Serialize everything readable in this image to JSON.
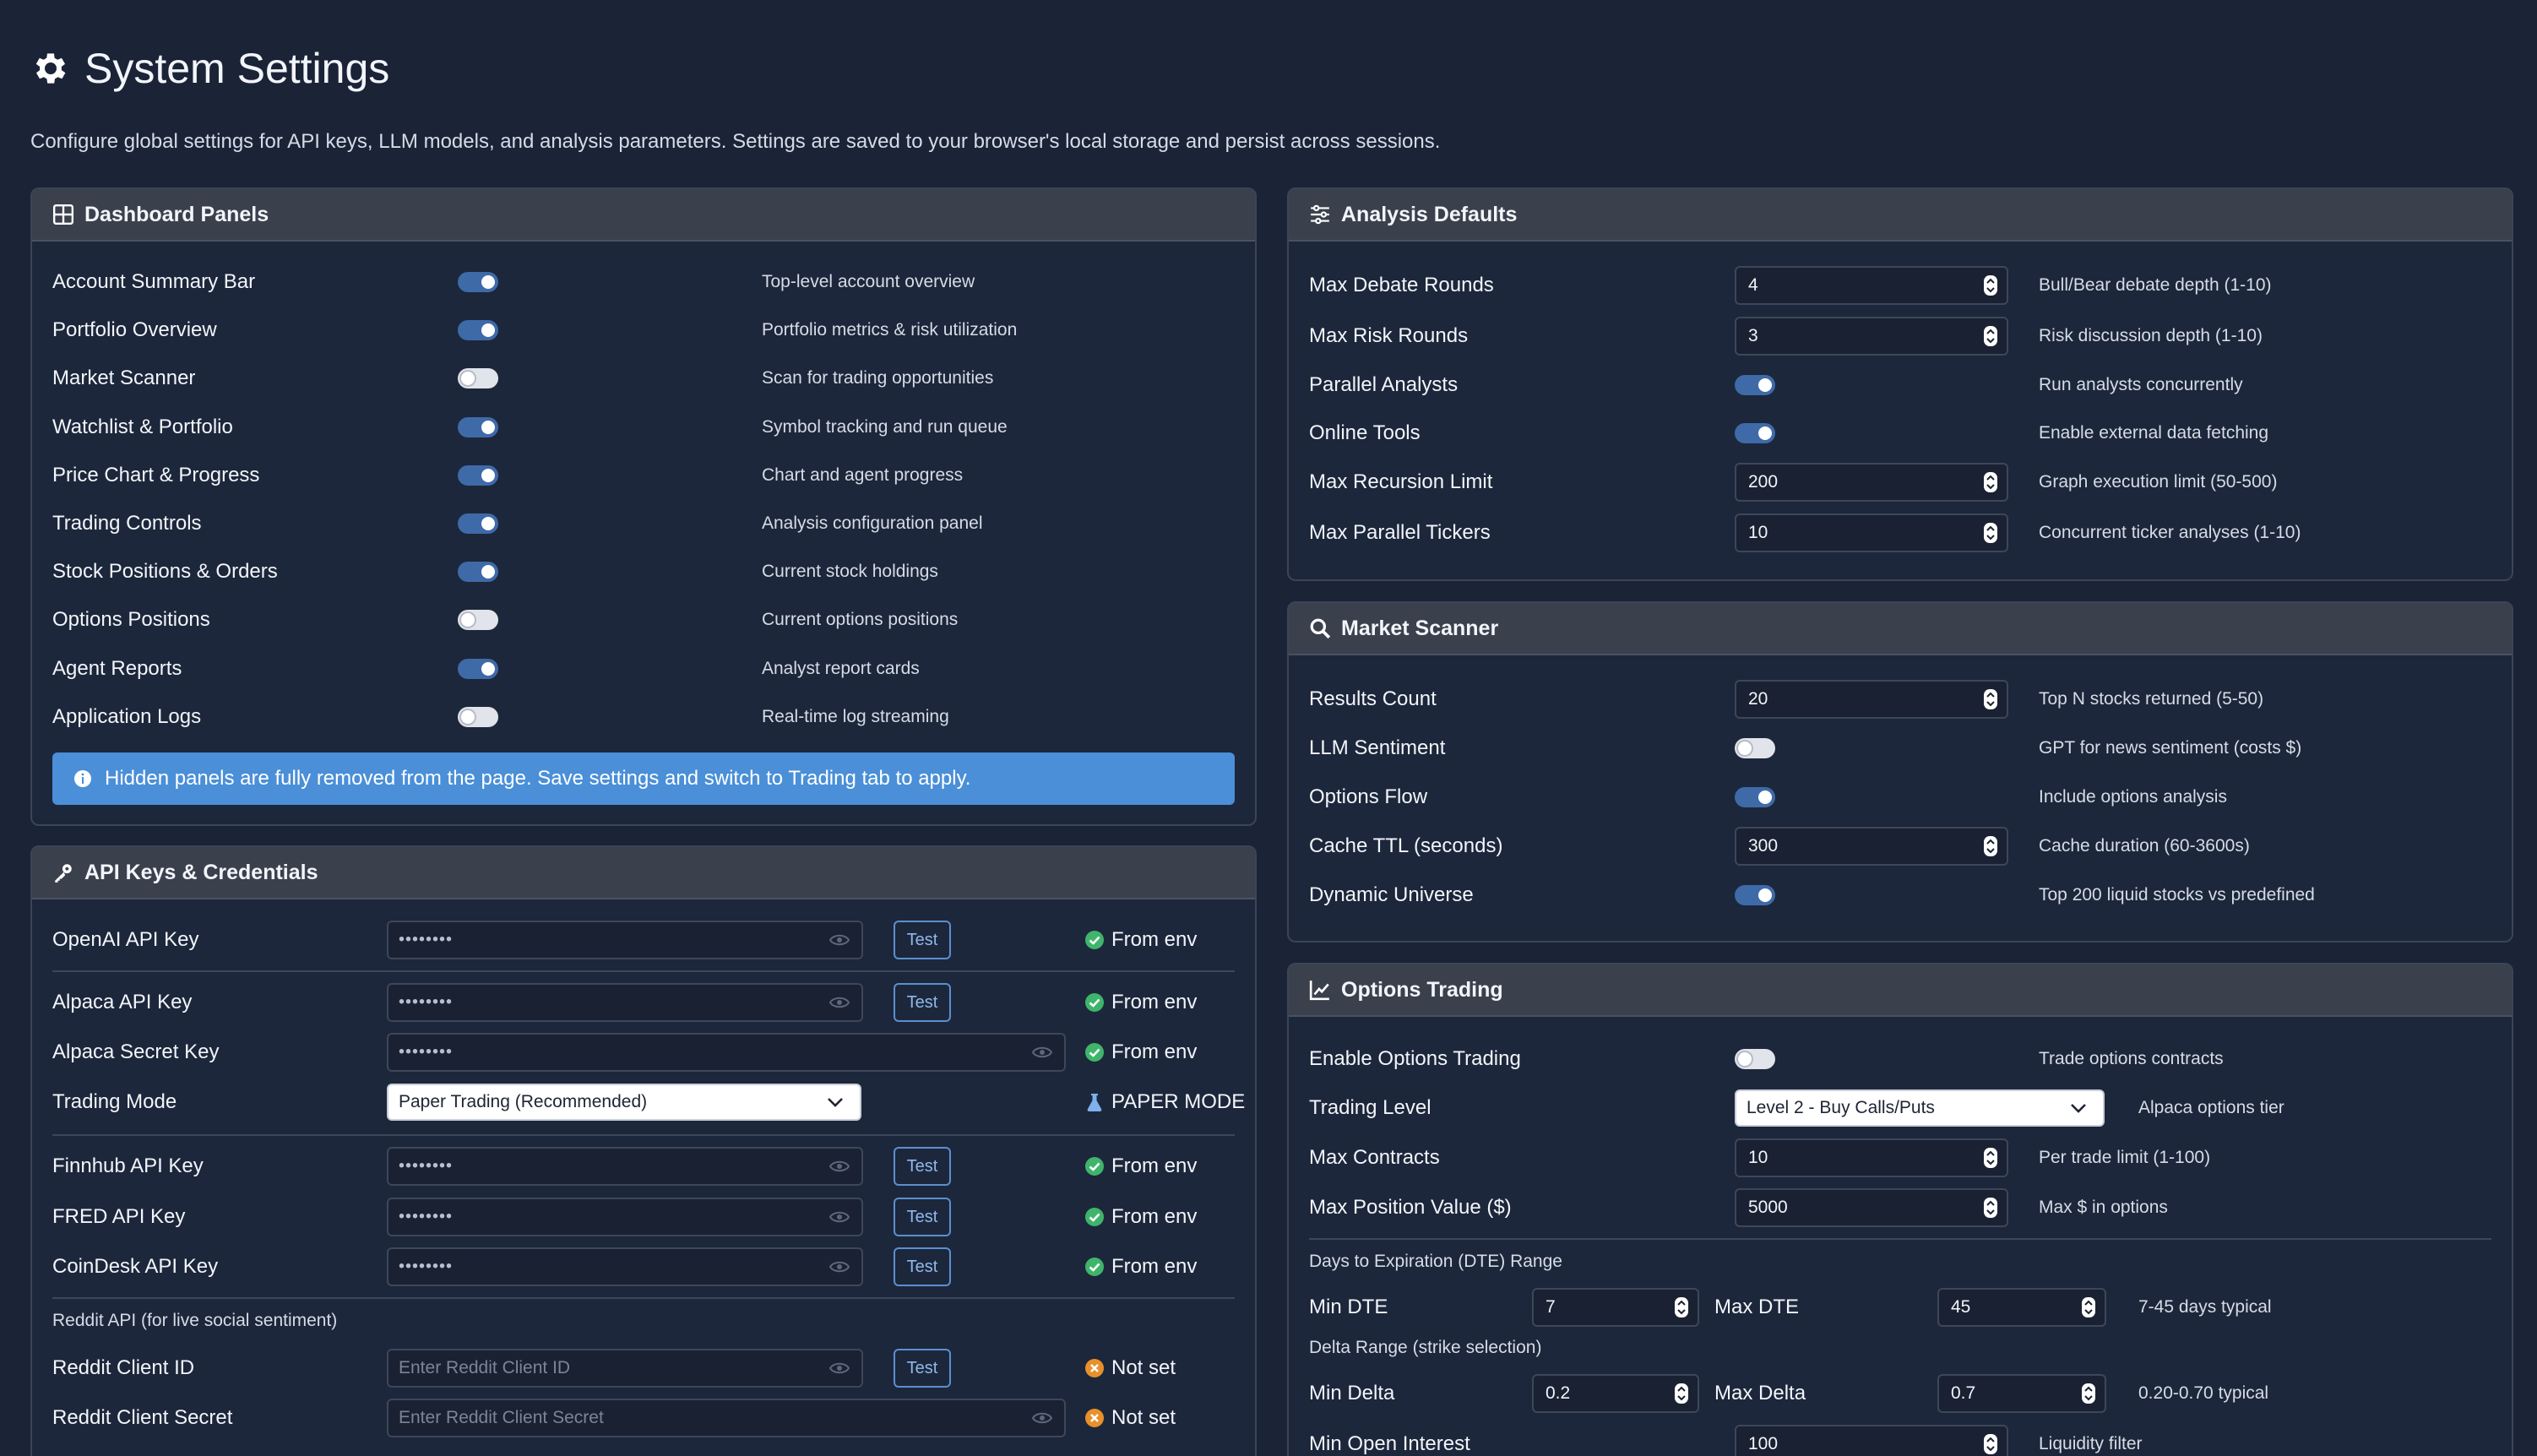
{
  "page": {
    "title": "System Settings",
    "description": "Configure global settings for API keys, LLM models, and analysis parameters. Settings are saved to your browser's local storage and persist across sessions."
  },
  "dashboard_panels": {
    "title": "Dashboard Panels",
    "items": [
      {
        "label": "Account Summary Bar",
        "enabled": true,
        "desc": "Top-level account overview"
      },
      {
        "label": "Portfolio Overview",
        "enabled": true,
        "desc": "Portfolio metrics & risk utilization"
      },
      {
        "label": "Market Scanner",
        "enabled": false,
        "desc": "Scan for trading opportunities"
      },
      {
        "label": "Watchlist & Portfolio",
        "enabled": true,
        "desc": "Symbol tracking and run queue"
      },
      {
        "label": "Price Chart & Progress",
        "enabled": true,
        "desc": "Chart and agent progress"
      },
      {
        "label": "Trading Controls",
        "enabled": true,
        "desc": "Analysis configuration panel"
      },
      {
        "label": "Stock Positions & Orders",
        "enabled": true,
        "desc": "Current stock holdings"
      },
      {
        "label": "Options Positions",
        "enabled": false,
        "desc": "Current options positions"
      },
      {
        "label": "Agent Reports",
        "enabled": true,
        "desc": "Analyst report cards"
      },
      {
        "label": "Application Logs",
        "enabled": false,
        "desc": "Real-time log streaming"
      }
    ],
    "info": "Hidden panels are fully removed from the page. Save settings and switch to Trading tab to apply."
  },
  "api_keys": {
    "title": "API Keys & Credentials",
    "test_label": "Test",
    "openai": {
      "label": "OpenAI API Key",
      "value": "••••••••",
      "status": "From env"
    },
    "alpaca_key": {
      "label": "Alpaca API Key",
      "value": "••••••••",
      "status": "From env"
    },
    "alpaca_secret": {
      "label": "Alpaca Secret Key",
      "value": "••••••••",
      "status": "From env"
    },
    "trading_mode": {
      "label": "Trading Mode",
      "value": "Paper Trading (Recommended)",
      "status": "PAPER MODE"
    },
    "finnhub": {
      "label": "Finnhub API Key",
      "value": "••••••••",
      "status": "From env"
    },
    "fred": {
      "label": "FRED API Key",
      "value": "••••••••",
      "status": "From env"
    },
    "coindesk": {
      "label": "CoinDesk API Key",
      "value": "••••••••",
      "status": "From env"
    },
    "reddit_heading": "Reddit API (for live social sentiment)",
    "reddit_id": {
      "label": "Reddit Client ID",
      "placeholder": "Enter Reddit Client ID",
      "status": "Not set"
    },
    "reddit_secret": {
      "label": "Reddit Client Secret",
      "placeholder": "Enter Reddit Client Secret",
      "status": "Not set"
    }
  },
  "analysis_defaults": {
    "title": "Analysis Defaults",
    "max_debate": {
      "label": "Max Debate Rounds",
      "value": "4",
      "desc": "Bull/Bear debate depth (1-10)"
    },
    "max_risk": {
      "label": "Max Risk Rounds",
      "value": "3",
      "desc": "Risk discussion depth (1-10)"
    },
    "parallel": {
      "label": "Parallel Analysts",
      "enabled": true,
      "desc": "Run analysts concurrently"
    },
    "online_tools": {
      "label": "Online Tools",
      "enabled": true,
      "desc": "Enable external data fetching"
    },
    "recursion": {
      "label": "Max Recursion Limit",
      "value": "200",
      "desc": "Graph execution limit (50-500)"
    },
    "parallel_tickers": {
      "label": "Max Parallel Tickers",
      "value": "10",
      "desc": "Concurrent ticker analyses (1-10)"
    }
  },
  "market_scanner": {
    "title": "Market Scanner",
    "results": {
      "label": "Results Count",
      "value": "20",
      "desc": "Top N stocks returned (5-50)"
    },
    "llm_sentiment": {
      "label": "LLM Sentiment",
      "enabled": false,
      "desc": "GPT for news sentiment (costs $)"
    },
    "options_flow": {
      "label": "Options Flow",
      "enabled": true,
      "desc": "Include options analysis"
    },
    "cache_ttl": {
      "label": "Cache TTL (seconds)",
      "value": "300",
      "desc": "Cache duration (60-3600s)"
    },
    "dynamic_universe": {
      "label": "Dynamic Universe",
      "enabled": true,
      "desc": "Top 200 liquid stocks vs predefined"
    }
  },
  "options_trading": {
    "title": "Options Trading",
    "enable": {
      "label": "Enable Options Trading",
      "enabled": false,
      "desc": "Trade options contracts"
    },
    "level": {
      "label": "Trading Level",
      "value": "Level 2 - Buy Calls/Puts",
      "desc": "Alpaca options tier"
    },
    "max_contracts": {
      "label": "Max Contracts",
      "value": "10",
      "desc": "Per trade limit (1-100)"
    },
    "max_position": {
      "label": "Max Position Value ($)",
      "value": "5000",
      "desc": "Max $ in options"
    },
    "dte_heading": "Days to Expiration (DTE) Range",
    "min_dte": {
      "label": "Min DTE",
      "value": "7"
    },
    "max_dte": {
      "label": "Max DTE",
      "value": "45"
    },
    "dte_desc": "7-45 days typical",
    "delta_heading": "Delta Range (strike selection)",
    "min_delta": {
      "label": "Min Delta",
      "value": "0.2"
    },
    "max_delta": {
      "label": "Max Delta",
      "value": "0.7"
    },
    "delta_desc": "0.20-0.70 typical",
    "min_oi": {
      "label": "Min Open Interest",
      "value": "100",
      "desc": "Liquidity filter"
    }
  },
  "colors": {
    "background": "#1b2337",
    "card_header": "#3a414d",
    "accent": "#3f6aa8",
    "info_banner": "#4a8fd8",
    "success": "#3fb56b",
    "warning": "#e8902a"
  }
}
